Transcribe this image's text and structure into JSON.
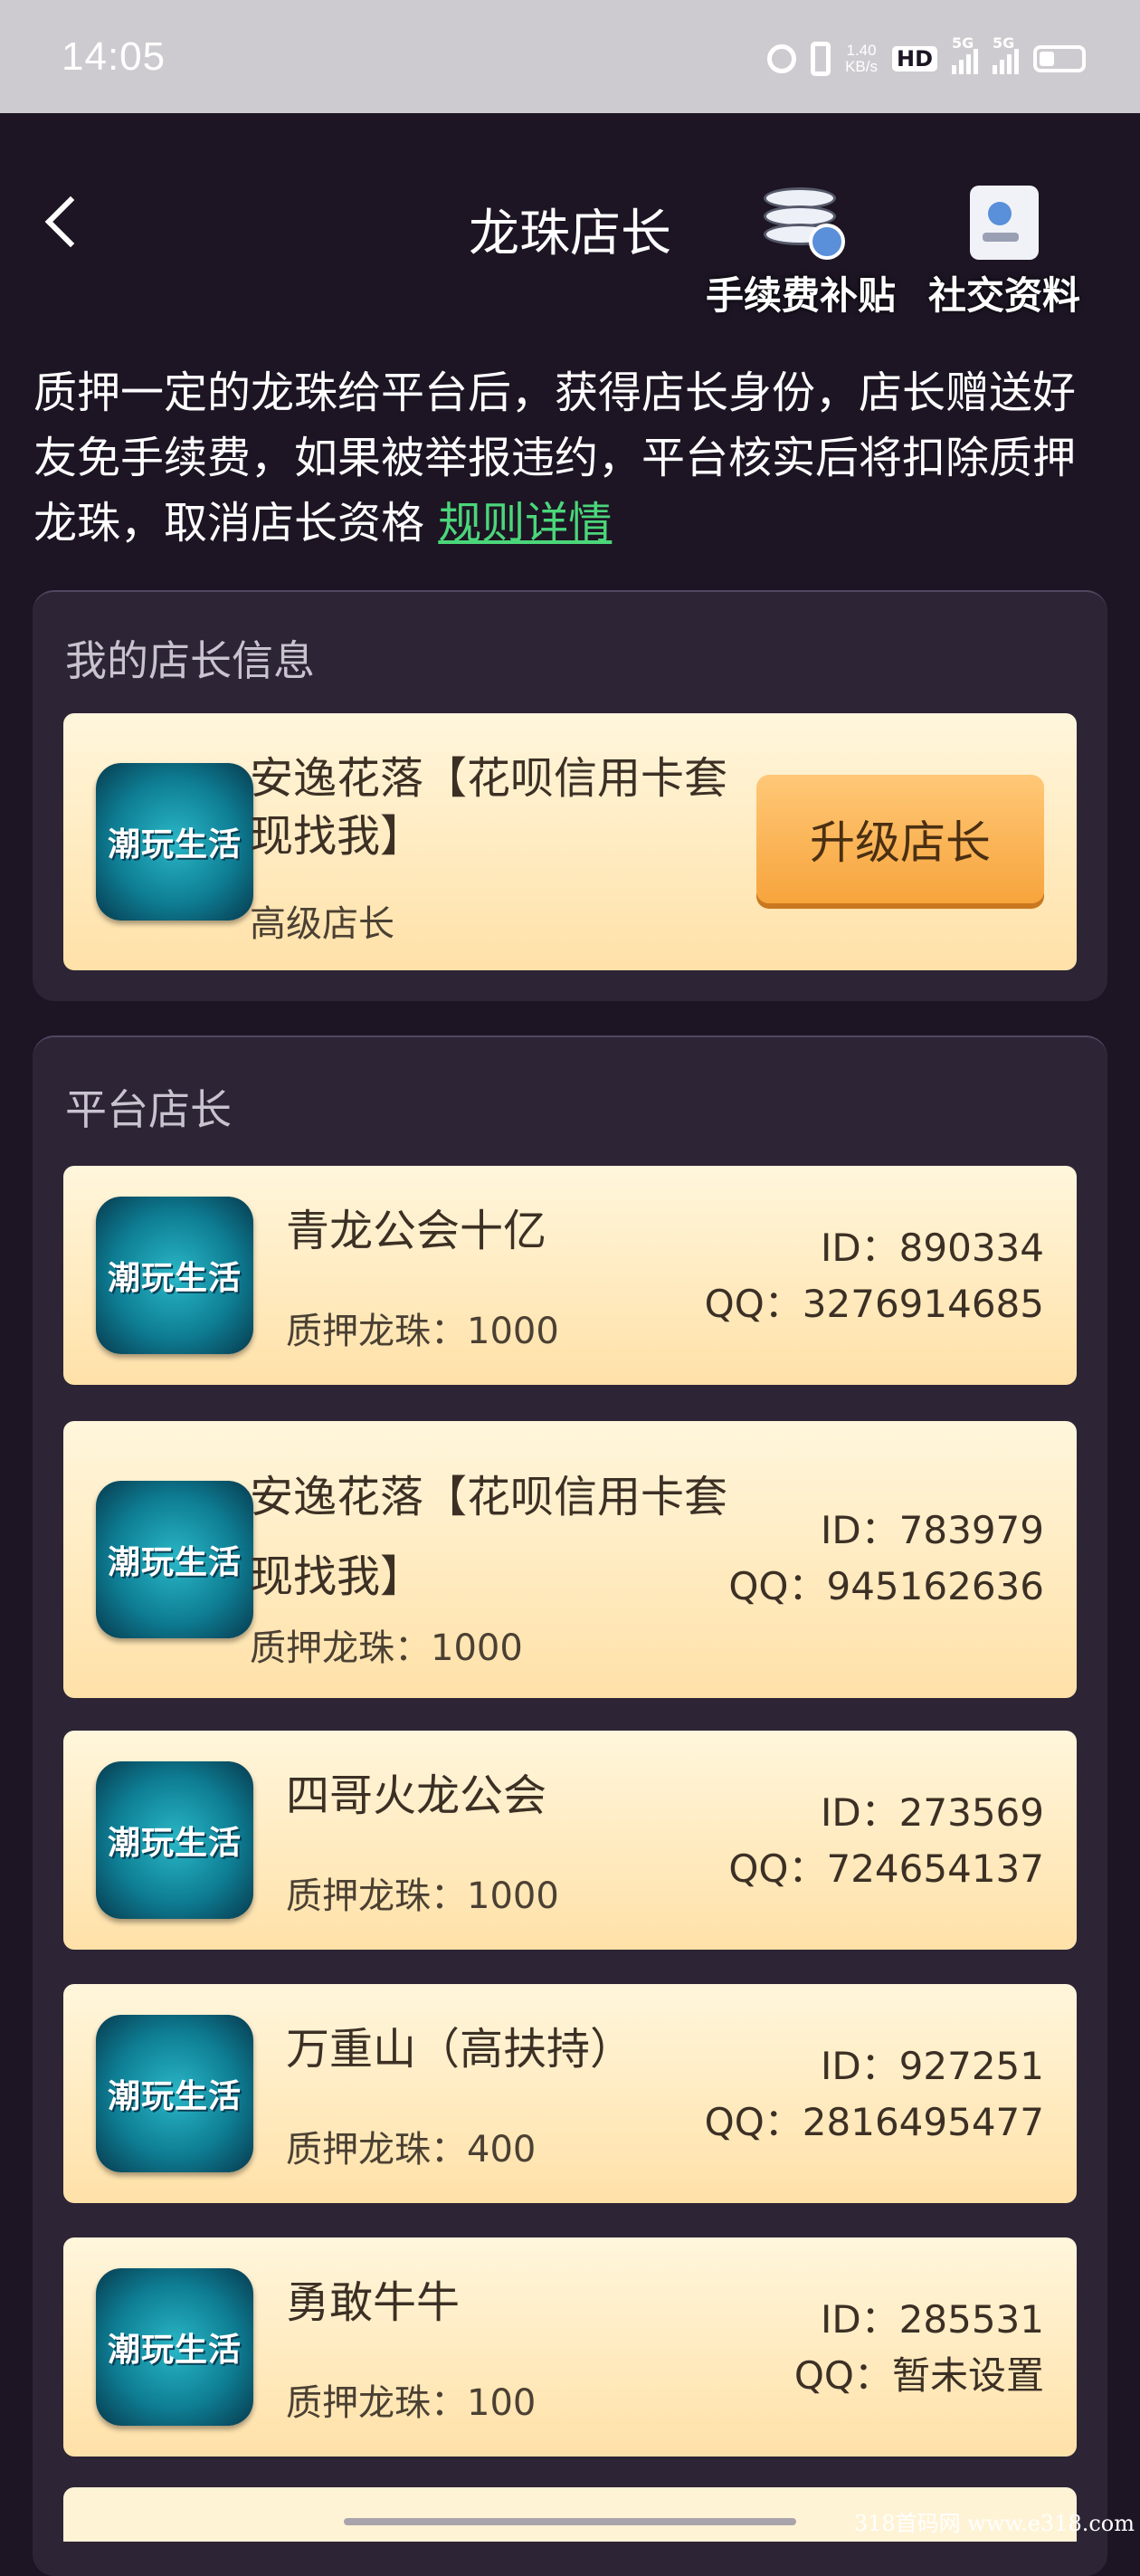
{
  "status_bar": {
    "time": "14:05",
    "net_speed_value": "1.40",
    "net_speed_unit": "KB/s",
    "hd_label": "HD",
    "sim1_label": "5G",
    "sim2_label": "5G"
  },
  "header": {
    "title": "龙珠店长",
    "fee_subsidy_label": "手续费补贴",
    "social_profile_label": "社交资料"
  },
  "intro": {
    "text": "质押一定的龙珠给平台后，获得店长身份，店长赠送好友免手续费，如果被举报违约，平台核实后将扣除质押龙珠，取消店长资格",
    "rule_link": "规则详情"
  },
  "my_info": {
    "section_title": "我的店长信息",
    "avatar_text": "潮玩生活",
    "name": "安逸花落【花呗信用卡套现找我】",
    "level": "高级店长",
    "upgrade_button": "升级店长"
  },
  "platform": {
    "section_title": "平台店长",
    "items": [
      {
        "avatar_text": "潮玩生活",
        "name": "青龙公会十亿",
        "pledge": "质押龙珠：1000",
        "id": "ID：890334",
        "qq": "QQ：3276914685"
      },
      {
        "avatar_text": "潮玩生活",
        "name": "安逸花落【花呗信用卡套现找我】",
        "pledge": "质押龙珠：1000",
        "id": "ID：783979",
        "qq": "QQ：945162636"
      },
      {
        "avatar_text": "潮玩生活",
        "name": "四哥火龙公会",
        "pledge": "质押龙珠：1000",
        "id": "ID：273569",
        "qq": "QQ：724654137"
      },
      {
        "avatar_text": "潮玩生活",
        "name": "万重山（高扶持）",
        "pledge": "质押龙珠：400",
        "id": "ID：927251",
        "qq": "QQ：2816495477"
      },
      {
        "avatar_text": "潮玩生活",
        "name": "勇敢牛牛",
        "pledge": "质押龙珠：100",
        "id": "ID：285531",
        "qq": "QQ：暂未设置"
      }
    ]
  },
  "watermark": "318首码网 www.e318.com"
}
